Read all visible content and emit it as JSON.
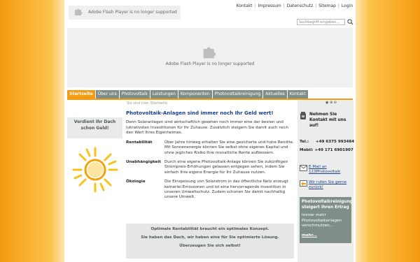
{
  "flash": {
    "small_text": "Adobe Flash Player is no longer supported",
    "big_text": "Adobe Flash Player is no longer supported"
  },
  "toplinks": [
    "Kontakt",
    "Impressum",
    "Datenschutz",
    "Sitemap",
    "Login"
  ],
  "search": {
    "placeholder": "Suchbegriff eingeben..."
  },
  "nav": {
    "tabs": [
      "Startseite",
      "Über uns",
      "Photovoltaik",
      "Leistungen",
      "Komponenten",
      "Photovoltaikreinigung",
      "Aktuelles",
      "Kontakt"
    ],
    "active": 0
  },
  "breadcrumb": "Sie sind hier: Startseite",
  "left": {
    "box_title": "Verdient Ihr Dach schon Geld!"
  },
  "content": {
    "title": "Photovoltaik-Anlagen sind immer noch Ihr Geld wert!",
    "intro": "Denn Solaranlagen sind wirtschaftlich gesehen noch immer eine der besten und lukrativsten Investitionen für Ihr Zuhause. Zusätzlich steigern Sie damit auch noch den Wert Ihres Eigenheimes.",
    "rows": [
      {
        "label": "Rentabilität",
        "text": "Über Jahre hinweg erhalten Sie eine gesicherte und hohe Rendite. Mit Sonnenenergie können Sie selbst ohne eigenes Kapital und ohne jegliches Risiko Ihre monatliche Rente aufbessern."
      },
      {
        "label": "Unabhängigkeit",
        "text": "Durch eine eigene Photovoltaik-Anlage können Sie zukünftigen Strompreis-Erhöhungen gelassen entgegen sehen, indem Sie einfach Ihre eigene Energie für Ihr Zuhause nutzen."
      },
      {
        "label": "Ökologie",
        "text": "Die Einspeisung von Solarstrom in das öffentliche Netz erzeugt keinerlei Emissionen und ist eine hervorragende Investition in unseren Umweltschutz. Zudem schonen Sie damit nachhaltig unsere Umwelt."
      }
    ],
    "note": [
      "Optimale Rentabilität braucht ein optimales Konzept.",
      "Sie haben das Dach, wir haben eine für Sie optimierte Lösung.",
      "Überzeugen Sie sich selbst!"
    ]
  },
  "right": {
    "font_controls": "◉ ⊕ ⊖",
    "contact_title": "Nehmen Sie Kontakt mit uns auf!",
    "tel_label": "Tel.:",
    "tel_value": "+49 6375 993484",
    "mobil_label": "Mobil:",
    "mobil_value": "+49 171 6901907",
    "mail_link": "E-Mail an 123Photovoltaik",
    "call_link": "Wir rufen Sie gerne zurück!",
    "promo_title": "Photovoltaikreinigung steigert Ihren Ertrag",
    "promo_body": "Immer mehr Photovoltaikanlagen verschmutzen...",
    "promo_more": "mehr..."
  },
  "colors": {
    "accent": "#f39c12",
    "nav": "#7f8f88",
    "title": "#1a3f8f"
  }
}
